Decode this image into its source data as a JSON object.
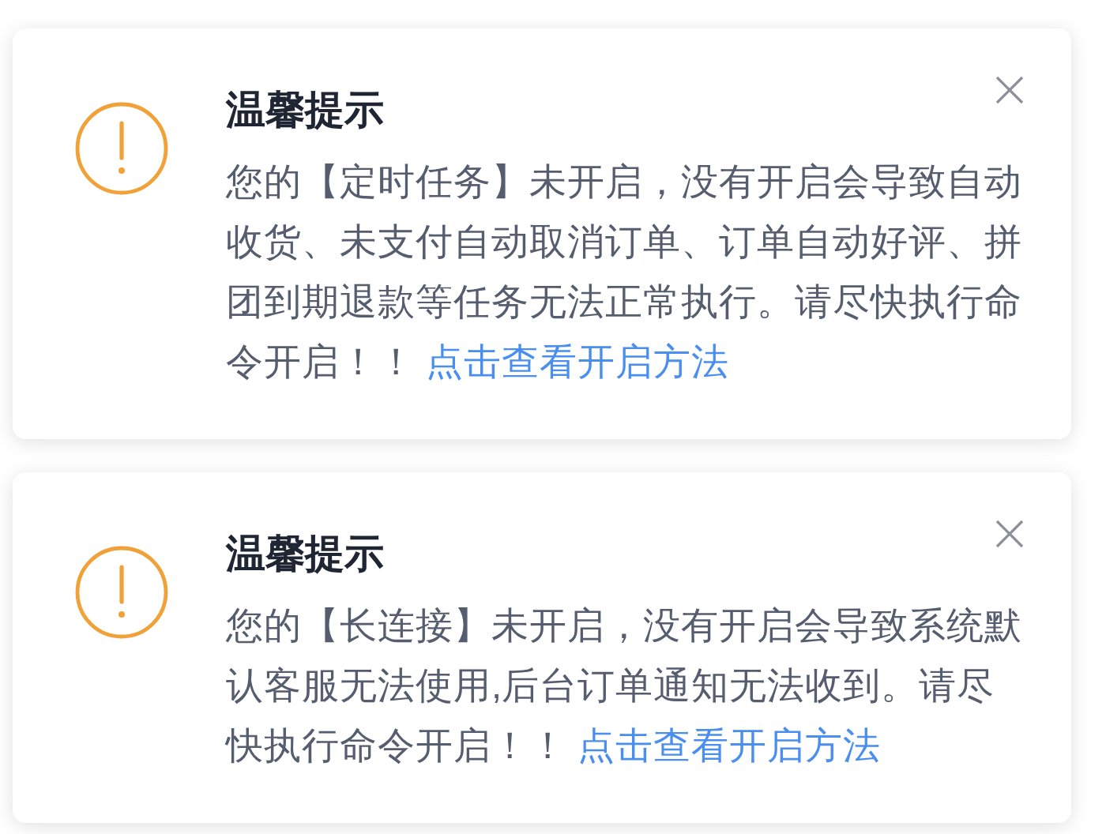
{
  "notices": [
    {
      "title": "温馨提示",
      "message": "您的【定时任务】未开启，没有开启会导致自动收货、未支付自动取消订单、订单自动好评、拼团到期退款等任务无法正常执行。请尽快执行命令开启！！",
      "link": "点击查看开启方法"
    },
    {
      "title": "温馨提示",
      "message": "您的【长连接】未开启，没有开启会导致系统默认客服无法使用,后台订单通知无法收到。请尽快执行命令开启！！",
      "link": "点击查看开启方法"
    }
  ]
}
